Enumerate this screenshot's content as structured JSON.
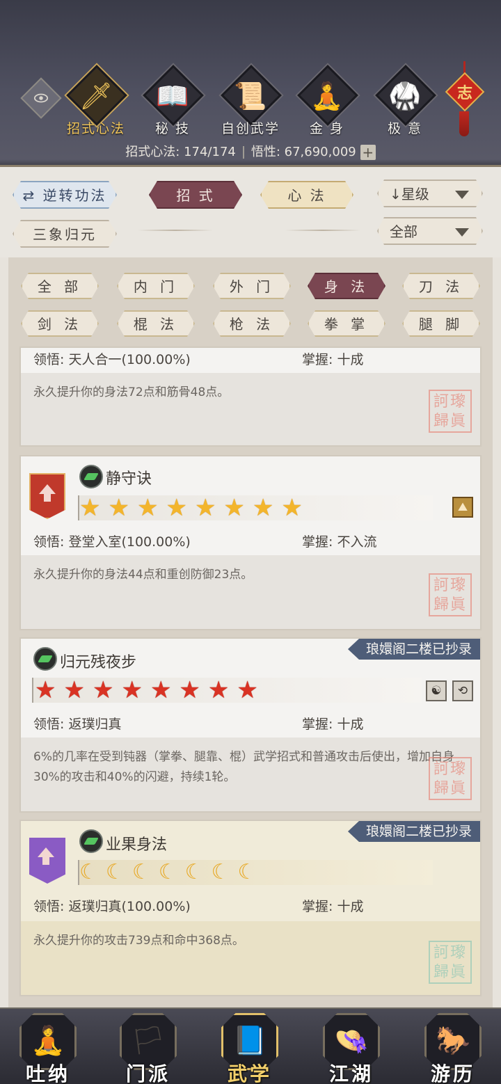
{
  "header": {
    "tabs": [
      {
        "label": "招式心法",
        "icon": "sword-icon",
        "glyph": "🗡",
        "active": true
      },
      {
        "label": "秘 技",
        "icon": "book-icon",
        "glyph": "📖",
        "active": false
      },
      {
        "label": "自创武学",
        "icon": "scroll-icon",
        "glyph": "📜",
        "active": false
      },
      {
        "label": "金 身",
        "icon": "meditation-icon",
        "glyph": "🧘",
        "active": false
      },
      {
        "label": "极 意",
        "icon": "martial-pose-icon",
        "glyph": "🥋",
        "active": false
      }
    ],
    "knot_char": "志",
    "stats_label_1": "招式心法: ",
    "stats_value_1": "174/174",
    "stats_label_2": "悟性: ",
    "stats_value_2": "67,690,009",
    "plus_label": "+"
  },
  "filters": {
    "reverse_button": "⇄ 逆转功法",
    "tab_moves": "招 式",
    "tab_mind": "心 法",
    "sort_dropdown": "↓星级",
    "sanxiang_button": "三象归元",
    "all_dropdown": "全部"
  },
  "categories": {
    "row1": [
      "全 部",
      "内 门",
      "外 门",
      "身 法",
      "刀 法"
    ],
    "row2": [
      "剑 法",
      "棍 法",
      "枪 法",
      "拳 掌",
      "腿 脚"
    ],
    "active": "身 法"
  },
  "seal_text_1": "訶瓈",
  "seal_text_2": "歸眞",
  "cards": [
    {
      "name": "",
      "comprehension": "领悟: 天人合一(100.00%)",
      "mastery": "掌握: 十成",
      "desc": "永久提升你的身法72点和筋骨48点。"
    },
    {
      "name": "静守诀",
      "rank_color": "red",
      "star_count": 8,
      "star_type": "gold-star",
      "comprehension": "领悟: 登堂入室(100.00%)",
      "mastery": "掌握: 不入流",
      "desc": "永久提升你的身法44点和重创防御23点。"
    },
    {
      "name": "归元残夜步",
      "tag": "琅嬛阁二楼已抄录",
      "star_count": 8,
      "star_type": "red-star",
      "comprehension": "领悟: 返璞归真",
      "mastery": "掌握: 十成",
      "desc": "6%的几率在受到钝器（掌拳、腿靠、棍）武学招式和普通攻击后使出，增加自身30%的攻击和40%的闪避，持续1轮。"
    },
    {
      "name": "业果身法",
      "tag": "琅嬛阁二楼已抄录",
      "rank_color": "purple",
      "moon_count": 7,
      "star_type": "moon",
      "comprehension": "领悟: 返璞归真(100.00%)",
      "mastery": "掌握: 十成",
      "desc": "永久提升你的攻击739点和命中368点。"
    }
  ],
  "bottom_nav": [
    {
      "label": "吐纳",
      "icon": "monk-icon",
      "glyph": "🧘",
      "active": false
    },
    {
      "label": "门派",
      "icon": "banner-icon",
      "glyph": "🏳",
      "active": false
    },
    {
      "label": "武学",
      "icon": "manual-book-icon",
      "glyph": "📘",
      "active": true
    },
    {
      "label": "江湖",
      "icon": "straw-hat-icon",
      "glyph": "👒",
      "active": false
    },
    {
      "label": "游历",
      "icon": "horse-icon",
      "glyph": "🐎",
      "active": false
    }
  ],
  "colors": {
    "header_bg": "#4f5060",
    "active_pill": "#7a4651",
    "gold_text": "#f1c65b",
    "tag_bg": "#4e5d78"
  }
}
